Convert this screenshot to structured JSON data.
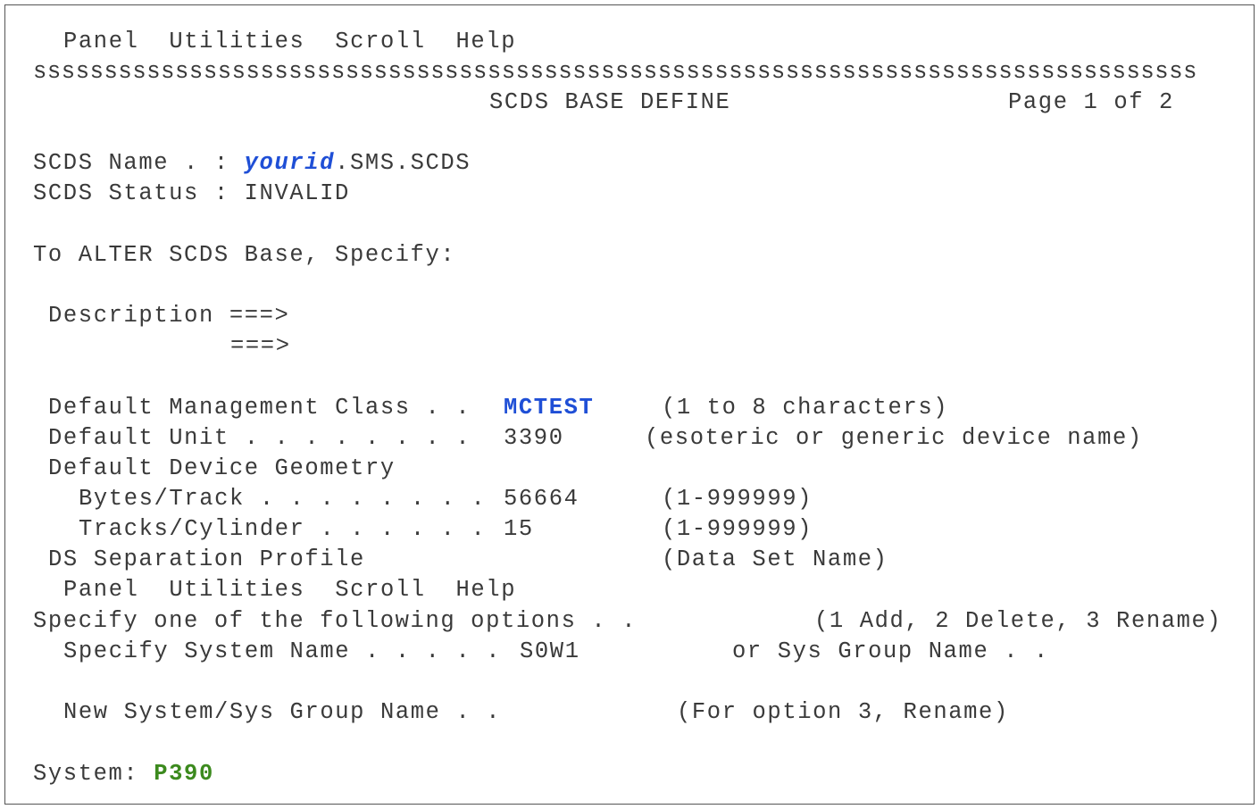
{
  "menu_top": {
    "panel": "Panel",
    "utilities": "Utilities",
    "scroll": "Scroll",
    "help": "Help"
  },
  "separator": "ssssssssssssssssssssssssssssssssssssssssssssssssssssssssssssssssssssssssssssssssss",
  "panel": {
    "title": "SCDS BASE DEFINE",
    "page": "Page 1 of 2"
  },
  "scds": {
    "name_label": "SCDS Name . :",
    "name_user": "yourid",
    "name_rest": ".SMS.SCDS",
    "status_label": "SCDS Status :",
    "status_value": "INVALID"
  },
  "instruction": "To ALTER SCDS Base, Specify:",
  "description": {
    "label": "Description ===>",
    "cont": "===>"
  },
  "fields": {
    "mgmt_label": "Default Management Class . .",
    "mgmt_value": "MCTEST",
    "mgmt_hint": "(1 to 8 characters)",
    "unit_label": "Default Unit . . . . . . . .",
    "unit_value": "3390",
    "unit_hint": "(esoteric or generic device name)",
    "geometry_label": "Default Device Geometry",
    "bytes_label": "Bytes/Track . . . . . . . .",
    "bytes_value": "56664",
    "bytes_hint": "(1-999999)",
    "tracks_label": "Tracks/Cylinder . . . . . .",
    "tracks_value": "15",
    "tracks_hint": "(1-999999)",
    "sep_profile_label": "DS Separation Profile",
    "sep_profile_hint": "(Data Set Name)"
  },
  "menu_second": {
    "panel": "Panel",
    "utilities": "Utilities",
    "scroll": "Scroll",
    "help": "Help"
  },
  "options": {
    "specify_label": "Specify one of the following options . .",
    "specify_hint": "(1 Add, 2 Delete, 3 Rename)",
    "system_label": "Specify System Name . . . . .",
    "system_value": "S0W1",
    "group_label": "or Sys Group Name . .",
    "new_label": "New System/Sys Group Name . .",
    "new_hint": "(For option 3, Rename)"
  },
  "footer": {
    "system_label": "System:",
    "system_value": "P390"
  }
}
